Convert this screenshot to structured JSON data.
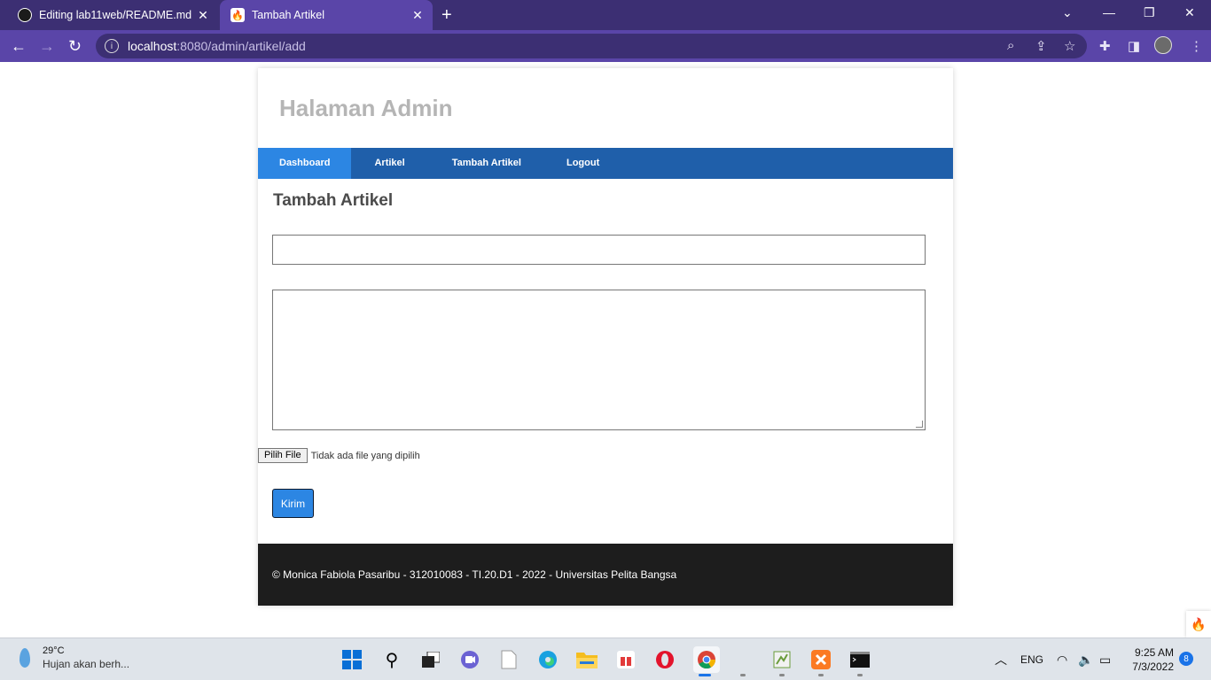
{
  "browser": {
    "tabs": [
      {
        "title": "Editing lab11web/README.md at",
        "icon": "github-icon",
        "close": "✕"
      },
      {
        "title": "Tambah Artikel",
        "icon": "codeigniter-icon",
        "close": "✕"
      }
    ],
    "new_tab": "+",
    "url_host": "localhost",
    "url_rest": ":8080/admin/artikel/add"
  },
  "page": {
    "site_title": "Halaman Admin",
    "nav": [
      {
        "label": "Dashboard",
        "active": true
      },
      {
        "label": "Artikel",
        "active": false
      },
      {
        "label": "Tambah Artikel",
        "active": false
      },
      {
        "label": "Logout",
        "active": false
      }
    ],
    "heading": "Tambah Artikel",
    "title_input": {
      "value": "",
      "placeholder": ""
    },
    "content_input": {
      "value": "",
      "placeholder": ""
    },
    "file": {
      "button": "Pilih File",
      "status": "Tidak ada file yang dipilih"
    },
    "submit_label": "Kirim",
    "footer": "© Monica Fabiola Pasaribu - 312010083 - TI.20.D1 - 2022 - Universitas Pelita Bangsa"
  },
  "taskbar": {
    "weather_temp": "29°C",
    "weather_desc": "Hujan akan berh...",
    "language": "ENG",
    "time": "9:25 AM",
    "date": "7/3/2022",
    "notifications": "8"
  },
  "colors": {
    "browser_frame": "#3c2f73",
    "nav_bar": "#1f5faa",
    "nav_active": "#2c86e3",
    "footer": "#1d1d1d",
    "button": "#2c86e3"
  }
}
